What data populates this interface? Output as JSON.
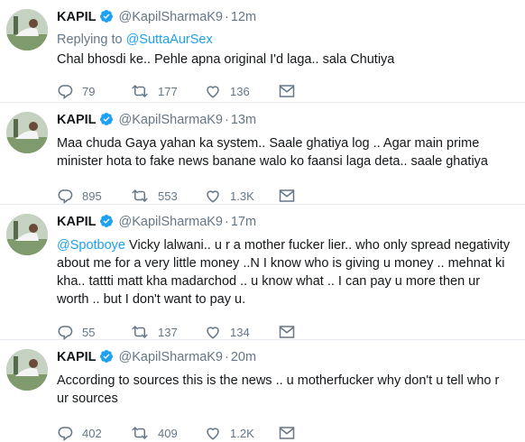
{
  "tweets": [
    {
      "name": "KAPIL",
      "handle": "@KapilSharmaK9",
      "time": "12m",
      "reply_prefix": "Replying to",
      "reply_to": "@SuttaAurSex",
      "mention": "",
      "text": "Chal bhosdi ke.. Pehle apna original I'd laga.. sala Chutiya",
      "replies": "79",
      "retweets": "177",
      "likes": "136"
    },
    {
      "name": "KAPIL",
      "handle": "@KapilSharmaK9",
      "time": "13m",
      "mention": "",
      "text": "Maa chuda Gaya yahan ka system.. Saale ghatiya log .. Agar main prime minister hota to fake news banane walo ko faansi laga deta.. saale ghatiya",
      "replies": "895",
      "retweets": "553",
      "likes": "1.3K"
    },
    {
      "name": "KAPIL",
      "handle": "@KapilSharmaK9",
      "time": "17m",
      "mention": "@Spotboye",
      "text": " Vicky lalwani.. u r a mother fucker lier.. who only spread negativity about me for a very little money ..N I know who is giving u money .. mehnat ki kha.. tattti matt kha madarchod .. u know what ..  I can pay u more then ur worth .. but I don't want to pay u.",
      "replies": "55",
      "retweets": "137",
      "likes": "134"
    },
    {
      "name": "KAPIL",
      "handle": "@KapilSharmaK9",
      "time": "20m",
      "mention": "",
      "text": "According to sources this is the news .. u motherfucker why don't u tell who r ur sources",
      "replies": "402",
      "retweets": "409",
      "likes": "1.2K"
    }
  ],
  "icons": {
    "reply": "reply-icon",
    "retweet": "retweet-icon",
    "like": "heart-icon",
    "dm": "envelope-icon",
    "verified": "verified-badge-icon",
    "avatar": "profile-avatar"
  },
  "colors": {
    "link": "#1da1f2",
    "muted": "#657786",
    "text": "#14171a",
    "divider": "#e6ecf0"
  }
}
